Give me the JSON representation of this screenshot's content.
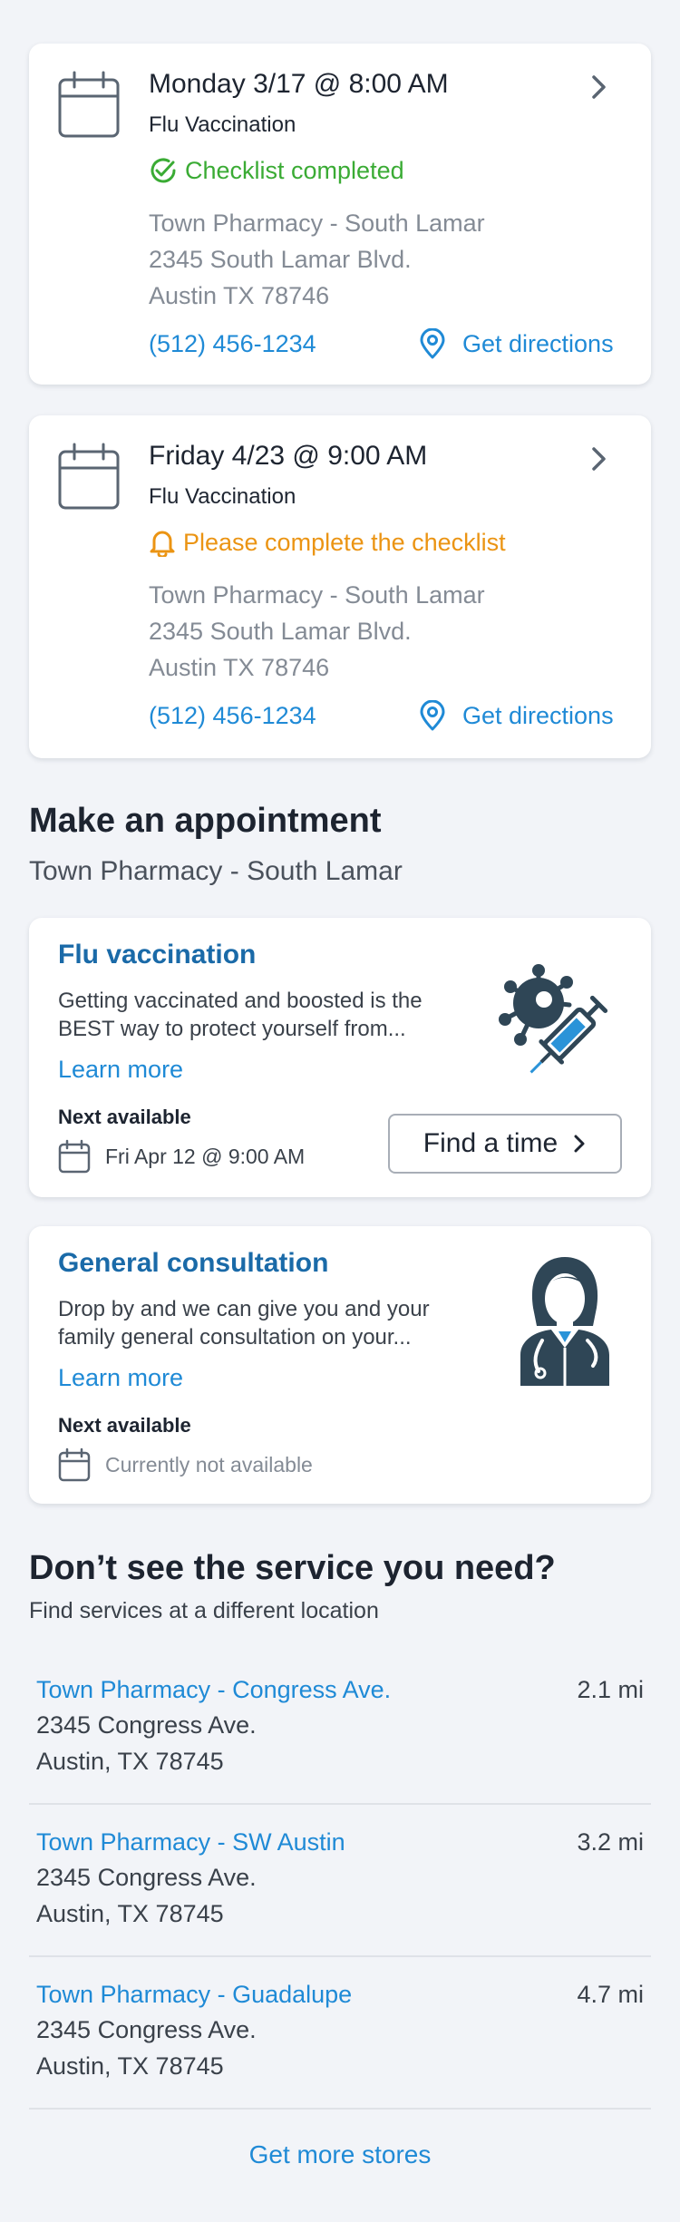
{
  "appointments": [
    {
      "date": "Monday 3/17 @ 8:00 AM",
      "type": "Flu Vaccination",
      "status": "Checklist completed",
      "status_kind": "complete",
      "store": "Town Pharmacy - South Lamar",
      "address1": "2345 South Lamar Blvd.",
      "address2": "Austin TX 78746",
      "phone": "(512) 456-1234",
      "directions": "Get directions"
    },
    {
      "date": "Friday 4/23 @ 9:00 AM",
      "type": "Flu Vaccination",
      "status": "Please complete the checklist",
      "status_kind": "pending",
      "store": "Town Pharmacy - South Lamar",
      "address1": "2345 South Lamar Blvd.",
      "address2": "Austin TX 78746",
      "phone": "(512) 456-1234",
      "directions": "Get directions"
    }
  ],
  "make_appointment": {
    "title": "Make an appointment",
    "subtitle": "Town Pharmacy - South Lamar"
  },
  "services": [
    {
      "title": "Flu vaccination",
      "desc_line1": "Getting vaccinated and boosted is the",
      "desc_line2": "BEST way to protect yourself from...",
      "learn_more": "Learn more",
      "next_label": "Next available",
      "next_value": "Fri Apr 12 @ 9:00 AM",
      "button": "Find a time",
      "icon": "virus-syringe-icon"
    },
    {
      "title": "General consultation",
      "desc_line1": "Drop by and we can give you and your",
      "desc_line2": "family general consultation on your...",
      "learn_more": "Learn more",
      "next_label": "Next available",
      "next_value": "Currently not available",
      "icon": "doctor-icon"
    }
  ],
  "other_locations": {
    "title": "Don’t see the service you need?",
    "subtitle": "Find services at a different location",
    "stores": [
      {
        "name": "Town Pharmacy - Congress Ave.",
        "distance": "2.1 mi",
        "address1": "2345 Congress Ave.",
        "address2": "Austin, TX 78745"
      },
      {
        "name": "Town Pharmacy - SW Austin",
        "distance": "3.2 mi",
        "address1": "2345 Congress Ave.",
        "address2": "Austin, TX 78745"
      },
      {
        "name": "Town Pharmacy - Guadalupe",
        "distance": "4.7 mi",
        "address1": "2345 Congress Ave.",
        "address2": "Austin, TX 78745"
      }
    ],
    "more": "Get more stores"
  },
  "colors": {
    "link": "#1f8ad6",
    "success": "#3aab34",
    "warning": "#eb9413",
    "service_title": "#1a6aa8",
    "icon_dark": "#2f4656"
  }
}
